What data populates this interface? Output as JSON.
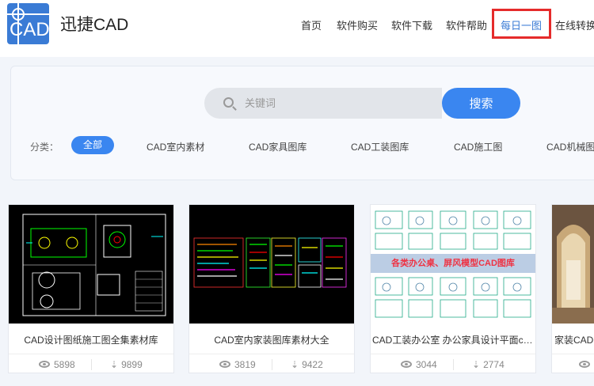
{
  "header": {
    "logo_text": "CAD",
    "brand": "迅捷CAD",
    "nav": [
      {
        "label": "首页"
      },
      {
        "label": "软件购买"
      },
      {
        "label": "软件下载"
      },
      {
        "label": "软件帮助"
      },
      {
        "label": "每日一图"
      },
      {
        "label": "在线转换"
      }
    ]
  },
  "search": {
    "placeholder": "关键词",
    "button": "搜索"
  },
  "categories": {
    "label": "分类：",
    "items": [
      "全部",
      "CAD室内素材",
      "CAD家具图库",
      "CAD工装图库",
      "CAD施工图",
      "CAD机械图"
    ]
  },
  "cards": [
    {
      "title": "CAD设计图纸施工图全集素材库",
      "views": "5898",
      "downloads": "9899"
    },
    {
      "title": "CAD室内家装图库素材大全",
      "views": "3819",
      "downloads": "9422"
    },
    {
      "title": "CAD工装办公室 办公家具设计平面ca...",
      "views": "3044",
      "downloads": "2774",
      "banner": "各类办公桌、屏风模型CAD图库"
    },
    {
      "title": "家装CAD",
      "views": "",
      "downloads": ""
    }
  ],
  "colors": {
    "accent": "#3a86f0",
    "highlight_border": "#e52b2b"
  }
}
